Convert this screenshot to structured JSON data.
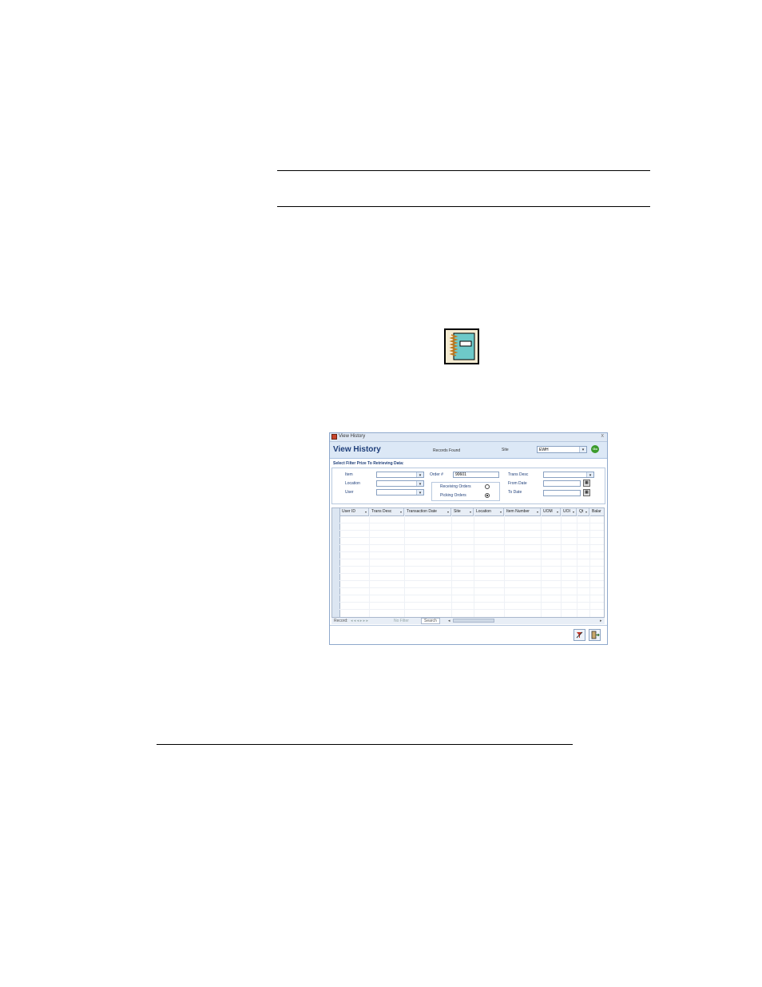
{
  "window": {
    "title": "View History",
    "close_glyph": "x",
    "header": {
      "title": "View History",
      "records_found_label": "Records Found",
      "site_label": "Site",
      "site_value": "EWH",
      "go_label": "Go"
    },
    "filter": {
      "heading": "Select Filter Prize To Retrieving Data:",
      "item_label": "Item",
      "location_label": "Location",
      "user_label": "User",
      "order_label": "Order #",
      "order_value": "90601",
      "receiving_label": "Receiving Orders",
      "picking_label": "Picking Orders",
      "selected_order_type": "Picking Orders",
      "trans_desc_label": "Trans Desc",
      "from_date_label": "From Date",
      "to_date_label": "To Date"
    },
    "grid": {
      "columns": [
        "User ID",
        "Trans Desc",
        "Transaction Date",
        "Site",
        "Location",
        "Item Number",
        "UOM",
        "UOI",
        "Qt",
        "Balar"
      ]
    },
    "navbar": {
      "record_label": "Record:",
      "nav_glyphs": "◂  ◂ ◂ ▸  ▸ ▸",
      "no_filter_label": "No Filter",
      "search_label": "Search"
    },
    "icons": [
      "notebook-icon",
      "app-icon",
      "go-icon",
      "calendar-icon",
      "clear-filter-icon",
      "exit-icon"
    ]
  }
}
